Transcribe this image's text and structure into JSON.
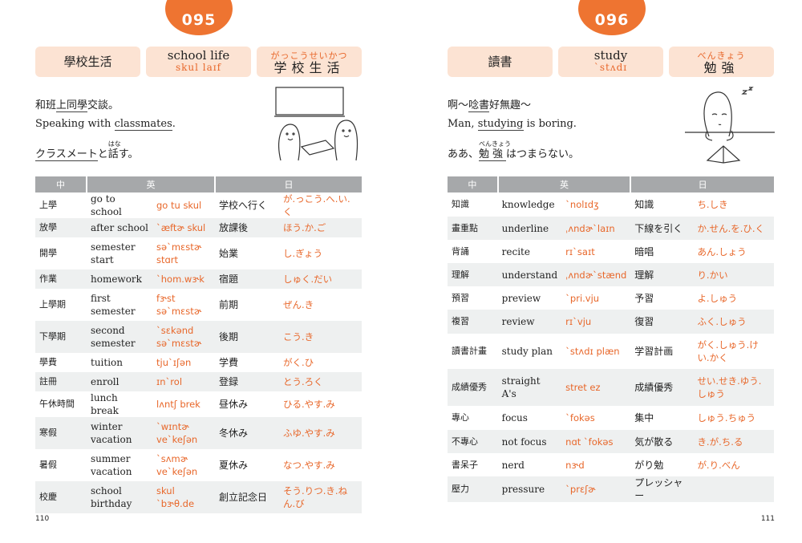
{
  "left": {
    "number": "095",
    "page_no": "110",
    "header": {
      "zh": "學校生活",
      "en": "school life",
      "en_ph": "skul laɪf",
      "jp_ruby": "がっこうせいかつ",
      "jp": "学校生活"
    },
    "example": {
      "zh_pre": "和班",
      "zh_u": "上同學",
      "zh_post": "交談。",
      "en_pre": "Speaking with ",
      "en_u": "classmates",
      "en_post": ".",
      "jp_u": "クラスメート",
      "jp_mid": "と",
      "jp_kanji": "話",
      "jp_ruby": "はな",
      "jp_post": "す。"
    },
    "columns": [
      "中",
      "英",
      "日"
    ],
    "rows": [
      [
        "上學",
        "go to school",
        "go tu skul",
        "学校へ行く",
        "が.っこう.へ.い.く"
      ],
      [
        "放學",
        "after school",
        "`æftɚ skul",
        "放課後",
        "ほう.か.ご"
      ],
      [
        "開學",
        "semester start",
        "sə`mɛstɚ stɑrt",
        "始業",
        "し.ぎょう"
      ],
      [
        "作業",
        "homework",
        "`hom.wɝk",
        "宿題",
        "しゅく.だい"
      ],
      [
        "上學期",
        "first semester",
        "fɝst sə`mɛstɚ",
        "前期",
        "ぜん.き"
      ],
      [
        "下學期",
        "second semester",
        "`sɛkənd sə`mɛstɚ",
        "後期",
        "こう.き"
      ],
      [
        "學費",
        "tuition",
        "tju`ɪʃən",
        "学費",
        "がく.ひ"
      ],
      [
        "註冊",
        "enroll",
        "ɪn`rol",
        "登録",
        "とう.ろく"
      ],
      [
        "午休時間",
        "lunch break",
        "lʌntʃ brek",
        "昼休み",
        "ひる.やす.み"
      ],
      [
        "寒假",
        "winter vacation",
        "`wɪntɚ ve`keʃən",
        "冬休み",
        "ふゆ.やす.み"
      ],
      [
        "暑假",
        "summer vacation",
        "`sʌmɚ ve`keʃən",
        "夏休み",
        "なつ.やす.み"
      ],
      [
        "校慶",
        "school birthday",
        "skul `bɝθ.de",
        "創立記念日",
        "そう.りつ.き.ねん.び"
      ]
    ]
  },
  "right": {
    "number": "096",
    "page_no": "111",
    "header": {
      "zh": "讀書",
      "en": "study",
      "en_ph": "`stʌdɪ",
      "jp_ruby": "べんきょう",
      "jp": "勉強"
    },
    "example": {
      "zh_pre": "啊～",
      "zh_u": "唸書",
      "zh_post": "好無趣～",
      "en_pre": "Man, ",
      "en_u": "studying",
      "en_post": " is boring.",
      "jp_pre": "ああ、",
      "jp_kanji": "勉強",
      "jp_ruby": "べんきょう",
      "jp_post": "はつまらない。"
    },
    "columns": [
      "中",
      "英",
      "日"
    ],
    "rows": [
      [
        "知識",
        "knowledge",
        "`nolɪdʒ",
        "知識",
        "ち.しき"
      ],
      [
        "畫重點",
        "underline",
        "ˌʌndɚ`laɪn",
        "下線を引く",
        "か.せん.を.ひ.く"
      ],
      [
        "背誦",
        "recite",
        "rɪ`saɪt",
        "暗唱",
        "あん.しょう"
      ],
      [
        "理解",
        "understand",
        "ˌʌndɚ`stænd",
        "理解",
        "り.かい"
      ],
      [
        "預習",
        "preview",
        "`pri.vju",
        "予習",
        "よ.しゅう"
      ],
      [
        "複習",
        "review",
        "rɪ`vju",
        "復習",
        "ふく.しゅう"
      ],
      [
        "讀書計畫",
        "study plan",
        "`stʌdɪ plæn",
        "学習計画",
        "がく.しゅう.けい.かく"
      ],
      [
        "成績優秀",
        "straight A's",
        "stret ez",
        "成績優秀",
        "せい.せき.ゆう.しゅう"
      ],
      [
        "專心",
        "focus",
        "`fokəs",
        "集中",
        "しゅう.ちゅう"
      ],
      [
        "不專心",
        "not focus",
        "nɑt `fokəs",
        "気が散る",
        "き.が.ち.る"
      ],
      [
        "書呆子",
        "nerd",
        "nɝd",
        "がり勉",
        "が.り.べん"
      ],
      [
        "壓力",
        "pressure",
        "`prɛʃɚ",
        "プレッシャー",
        ""
      ]
    ]
  },
  "colors": {
    "accent": "#ee7431",
    "header_bg": "#fce3d3",
    "table_head": "#a6a8aa",
    "stripe": "#eef0f0"
  }
}
